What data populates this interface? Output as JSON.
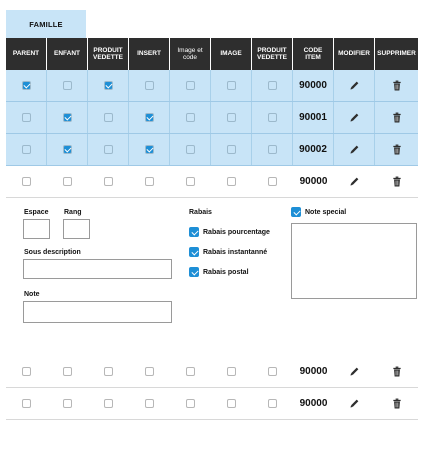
{
  "family_tab": "FAMILLE",
  "columns": [
    {
      "label": "PARENT"
    },
    {
      "label": "ENFANT"
    },
    {
      "label": "PRODUIT VEDETTE"
    },
    {
      "label": "INSERT"
    },
    {
      "label": "Image et code"
    },
    {
      "label": "IMAGE"
    },
    {
      "label": "PRODUIT VEDETTE"
    },
    {
      "label": "CODE ITEM"
    },
    {
      "label": "MODIFIER"
    },
    {
      "label": "SUPPRIMER"
    }
  ],
  "rows": [
    {
      "selected": true,
      "checks": [
        true,
        false,
        true,
        false,
        false,
        false,
        false
      ],
      "code": "90000"
    },
    {
      "selected": true,
      "checks": [
        false,
        true,
        false,
        true,
        false,
        false,
        false
      ],
      "code": "90001"
    },
    {
      "selected": true,
      "checks": [
        false,
        true,
        false,
        true,
        false,
        false,
        false
      ],
      "code": "90002"
    },
    {
      "selected": false,
      "checks": [
        false,
        false,
        false,
        false,
        false,
        false,
        false
      ],
      "code": "90000"
    },
    {
      "selected": false,
      "checks": [
        false,
        false,
        false,
        false,
        false,
        false,
        false
      ],
      "code": "90000"
    },
    {
      "selected": false,
      "checks": [
        false,
        false,
        false,
        false,
        false,
        false,
        false
      ],
      "code": "90000"
    }
  ],
  "detail": {
    "espace_label": "Espace",
    "rang_label": "Rang",
    "sous_description_label": "Sous description",
    "note_label": "Note",
    "rabais_label": "Rabais",
    "rabais_options": [
      {
        "label": "Rabais pourcentage",
        "checked": true
      },
      {
        "label": "Rabais instantanné",
        "checked": true
      },
      {
        "label": "Rabais postal",
        "checked": true
      }
    ],
    "note_special_label": "Note special",
    "note_special_checked": true
  },
  "icons": {
    "edit": "pencil-icon",
    "delete": "trash-icon"
  },
  "colors": {
    "selected_row": "#c8e4f7",
    "header": "#2e2e2e",
    "checkbox_on": "#1e8fd6"
  }
}
